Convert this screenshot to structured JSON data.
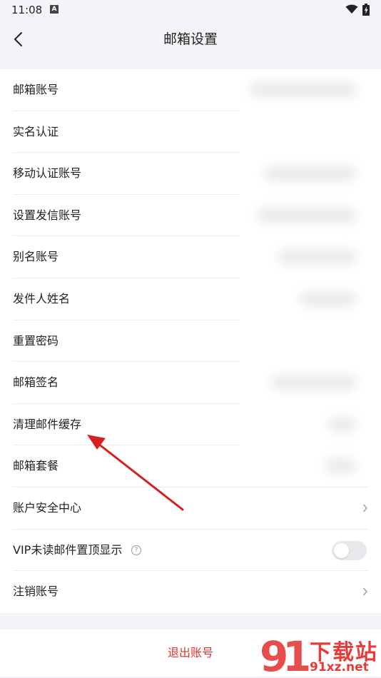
{
  "status_bar": {
    "time": "11:08",
    "notification_icon": "A"
  },
  "nav": {
    "title": "邮箱设置",
    "back_icon": "chevron-left-icon"
  },
  "settings": {
    "items": [
      {
        "label": "邮箱账号"
      },
      {
        "label": "实名认证"
      },
      {
        "label": "移动认证账号"
      },
      {
        "label": "设置发信账号"
      },
      {
        "label": "别名账号"
      },
      {
        "label": "发件人姓名"
      },
      {
        "label": "重置密码"
      },
      {
        "label": "邮箱签名"
      },
      {
        "label": "清理邮件缓存"
      },
      {
        "label": "邮箱套餐"
      },
      {
        "label": "账户安全中心"
      },
      {
        "label": "VIP未读邮件置顶显示",
        "help_icon": "?"
      },
      {
        "label": "注销账号"
      }
    ]
  },
  "logout": {
    "label": "退出账号",
    "color": "#e0322c"
  },
  "watermark": {
    "logo_text": "下载站",
    "domain": "91xz.net",
    "color": "#e43b3b"
  },
  "colors": {
    "background": "#f4f4f8",
    "card": "#ffffff",
    "annotation_arrow": "#d42020"
  }
}
